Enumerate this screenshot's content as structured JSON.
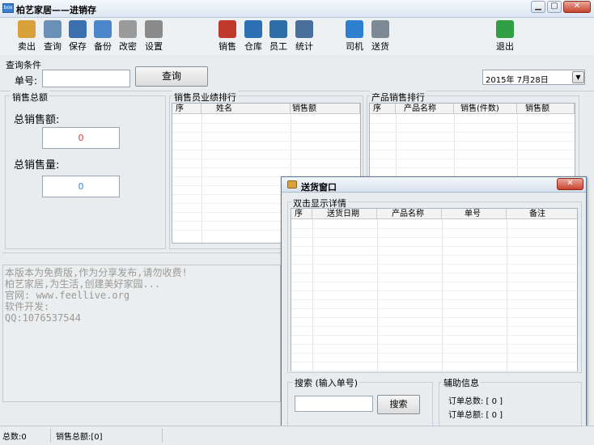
{
  "window": {
    "title": "柏艺家居——进销存",
    "app_icon": "box",
    "caption_buttons": [
      "minimize",
      "maximize",
      "close"
    ]
  },
  "toolbar": {
    "buttons": [
      {
        "label": "卖出",
        "icon": "cart-icon",
        "color": "#d8a23a"
      },
      {
        "label": "查询",
        "icon": "magnifier-icon",
        "color": "#6a90b8"
      },
      {
        "label": "保存",
        "icon": "save-icon",
        "color": "#3b6fb0"
      },
      {
        "label": "备份",
        "icon": "backup-icon",
        "color": "#4b87c9"
      },
      {
        "label": "改密",
        "icon": "lock-icon",
        "color": "#9a9a9a"
      },
      {
        "label": "设置",
        "icon": "gear-icon",
        "color": "#8a8a8a"
      },
      {
        "label": "销售",
        "icon": "basket-icon",
        "color": "#c0392b"
      },
      {
        "label": "仓库",
        "icon": "box-icon",
        "color": "#2c6fb5"
      },
      {
        "label": "员工",
        "icon": "person-icon",
        "color": "#2d6ea8"
      },
      {
        "label": "统计",
        "icon": "building-chart-icon",
        "color": "#4a6f9a"
      },
      {
        "label": "司机",
        "icon": "driver-icon",
        "color": "#2e7fcf"
      },
      {
        "label": "送货",
        "icon": "truck-icon",
        "color": "#7d8a96"
      },
      {
        "label": "退出",
        "icon": "exit-icon",
        "color": "#2f9e44"
      }
    ]
  },
  "query": {
    "legend": "查询条件",
    "order_label": "单号:",
    "order_value": "",
    "query_button": "查询",
    "date_value": "2015年  7月28日"
  },
  "sales_total": {
    "legend": "销售总额",
    "total_amount_label": "总销售额:",
    "total_amount_value": "0",
    "total_qty_label": "总销售量:",
    "total_qty_value": "0"
  },
  "staff_ranking": {
    "legend": "销售员业绩排行",
    "columns": [
      "序",
      "姓名",
      "销售额"
    ]
  },
  "product_ranking": {
    "legend": "产品销售排行",
    "columns": [
      "序",
      "产品名称",
      "销售(件数)",
      "销售额"
    ]
  },
  "notice": [
    "本版本为免费版,作为分享发布,请勿收费!",
    "柏艺家居,为生活,创建美好家园...",
    "官网: www.feellive.org",
    "软件开发:",
    "QQ:1076537544"
  ],
  "delivery_dialog": {
    "title": "送货窗口",
    "hint": "双击显示详情",
    "columns": [
      "序",
      "送货日期",
      "产品名称",
      "单号",
      "备注"
    ],
    "search_legend": "搜索 (输入单号)",
    "search_value": "",
    "search_button": "搜索",
    "aux_legend": "辅助信息",
    "order_count": "订单总数: [ 0 ]",
    "order_total": "订单总额: [ 0 ]"
  },
  "status": {
    "total_count": "总数:0",
    "sales_total": "销售总额:[0]"
  },
  "colors": {
    "value_red": "#e53935",
    "value_blue": "#2d8be0"
  }
}
